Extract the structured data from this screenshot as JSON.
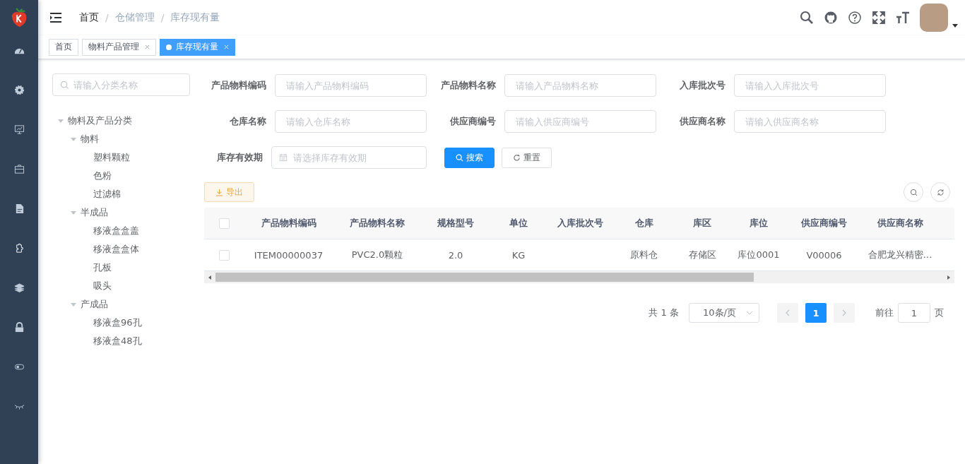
{
  "breadcrumb": {
    "separator": "/",
    "items": [
      {
        "label": "首页"
      },
      {
        "label": "仓储管理"
      },
      {
        "label": "库存现有量"
      }
    ]
  },
  "tags": [
    {
      "label": "首页",
      "selected": false,
      "closable": false
    },
    {
      "label": "物料产品管理",
      "selected": false,
      "closable": true
    },
    {
      "label": "库存现有量",
      "selected": true,
      "closable": true
    }
  ],
  "tree": {
    "placeholder": "请输入分类名称",
    "nodes": [
      {
        "label": "物料及产品分类",
        "expanded": true,
        "children": [
          {
            "label": "物料",
            "expanded": true,
            "children": [
              {
                "label": "塑料颗粒"
              },
              {
                "label": "色粉"
              },
              {
                "label": "过滤棉"
              }
            ]
          },
          {
            "label": "半成品",
            "expanded": true,
            "children": [
              {
                "label": "移液盒盒盖"
              },
              {
                "label": "移液盒盒体"
              },
              {
                "label": "孔板"
              },
              {
                "label": "吸头"
              }
            ]
          },
          {
            "label": "产成品",
            "expanded": true,
            "children": [
              {
                "label": "移液盒96孔"
              },
              {
                "label": "移液盒48孔"
              }
            ]
          }
        ]
      }
    ]
  },
  "filters": [
    {
      "label": "产品物料编码",
      "placeholder": "请输入产品物料编码",
      "kind": "text"
    },
    {
      "label": "产品物料名称",
      "placeholder": "请输入产品物料名称",
      "kind": "text"
    },
    {
      "label": "入库批次号",
      "placeholder": "请输入入库批次号",
      "kind": "text"
    },
    {
      "label": "仓库名称",
      "placeholder": "请输入仓库名称",
      "kind": "text"
    },
    {
      "label": "供应商编号",
      "placeholder": "请输入供应商编号",
      "kind": "text"
    },
    {
      "label": "供应商名称",
      "placeholder": "请输入供应商名称",
      "kind": "text"
    },
    {
      "label": "库存有效期",
      "placeholder": "请选择库存有效期",
      "kind": "date"
    }
  ],
  "search_button": "搜索",
  "reset_button": "重置",
  "export_button": "导出",
  "table": {
    "columns": [
      "产品物料编码",
      "产品物料名称",
      "规格型号",
      "单位",
      "入库批次号",
      "仓库",
      "库区",
      "库位",
      "供应商编号",
      "供应商名称"
    ],
    "all_checked": false,
    "rows": [
      {
        "checked": false,
        "cells": [
          "ITEM00000037",
          "PVC2.0颗粒",
          "2.0",
          "KG",
          "",
          "原料仓",
          "存储区",
          "库位0001",
          "V00006",
          "合肥龙兴精密…"
        ]
      }
    ]
  },
  "pagination": {
    "total": "共 1 条",
    "page_size": "10条/页",
    "pages": [
      {
        "label": "1",
        "selected": true
      }
    ],
    "goto_label": "前往",
    "goto_value": "1",
    "goto_suffix": "页"
  }
}
